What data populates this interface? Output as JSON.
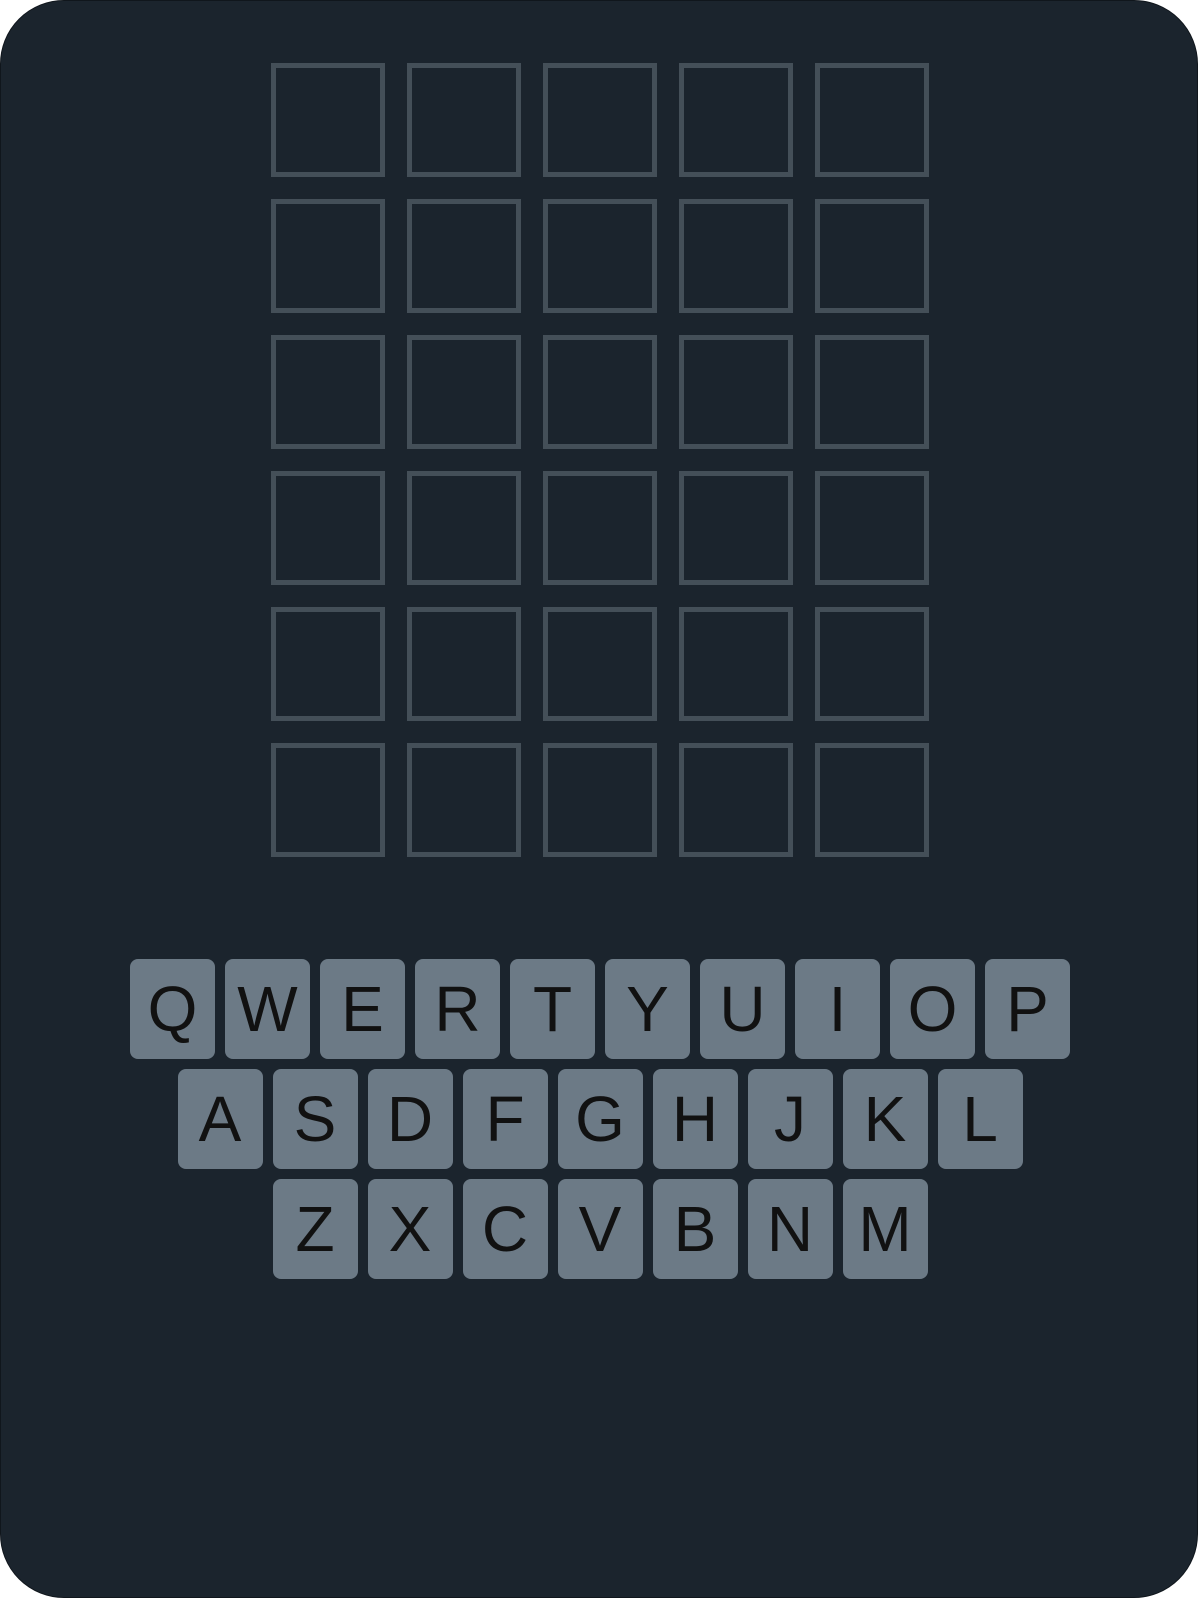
{
  "colors": {
    "background": "#1b242d",
    "tile_border": "#444f58",
    "key_fill": "#6c7a86",
    "key_text": "#111111"
  },
  "board": {
    "rows": [
      [
        "",
        "",
        "",
        "",
        ""
      ],
      [
        "",
        "",
        "",
        "",
        ""
      ],
      [
        "",
        "",
        "",
        "",
        ""
      ],
      [
        "",
        "",
        "",
        "",
        ""
      ],
      [
        "",
        "",
        "",
        "",
        ""
      ],
      [
        "",
        "",
        "",
        "",
        ""
      ]
    ]
  },
  "keyboard": {
    "rows": [
      [
        "Q",
        "W",
        "E",
        "R",
        "T",
        "Y",
        "U",
        "I",
        "O",
        "P"
      ],
      [
        "A",
        "S",
        "D",
        "F",
        "G",
        "H",
        "J",
        "K",
        "L"
      ],
      [
        "Z",
        "X",
        "C",
        "V",
        "B",
        "N",
        "M"
      ]
    ]
  }
}
